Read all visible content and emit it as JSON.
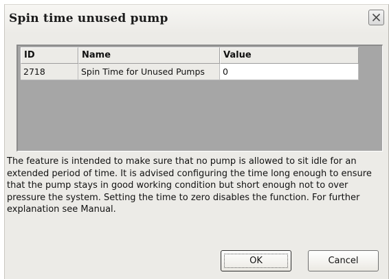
{
  "window": {
    "title": "Spin time unused pump",
    "close_icon": "close-icon"
  },
  "grid": {
    "columns": [
      "ID",
      "Name",
      "Value"
    ],
    "rows": [
      {
        "id": "2718",
        "name": "Spin Time for Unused Pumps",
        "value": "0"
      }
    ]
  },
  "description": "The feature is intended to make sure that no pump is allowed to sit idle for an extended period of time. It is advised configuring the time long enough to ensure that the pump stays in good working condition but short enough not to over pressure the system. Setting the time to zero disables the function. For further explanation see Manual.",
  "buttons": {
    "ok_label": "OK",
    "cancel_label": "Cancel"
  }
}
